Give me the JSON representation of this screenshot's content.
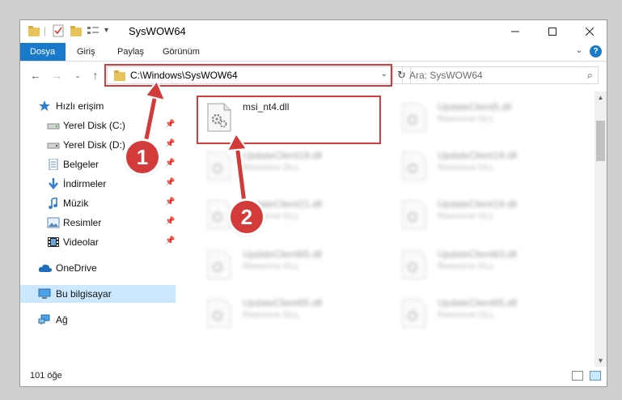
{
  "window": {
    "title": "SysWOW64"
  },
  "ribbon": {
    "tabs": [
      {
        "label": "Dosya"
      },
      {
        "label": "Giriş"
      },
      {
        "label": "Paylaş"
      },
      {
        "label": "Görünüm"
      }
    ],
    "help_label": "?"
  },
  "address": {
    "path": "C:\\Windows\\SysWOW64"
  },
  "search": {
    "placeholder": "Ara: SysWOW64"
  },
  "sidebar": {
    "items": [
      {
        "label": "Hızlı erişim",
        "icon": "star-icon"
      },
      {
        "label": "Yerel Disk (C:)",
        "icon": "drive-icon"
      },
      {
        "label": "Yerel Disk (D:)",
        "icon": "drive-icon"
      },
      {
        "label": "Belgeler",
        "icon": "documents-icon"
      },
      {
        "label": "İndirmeler",
        "icon": "downloads-icon"
      },
      {
        "label": "Müzik",
        "icon": "music-icon"
      },
      {
        "label": "Resimler",
        "icon": "pictures-icon"
      },
      {
        "label": "Videolar",
        "icon": "videos-icon"
      },
      {
        "label": "OneDrive",
        "icon": "cloud-icon"
      },
      {
        "label": "Bu bilgisayar",
        "icon": "computer-icon"
      },
      {
        "label": "Ağ",
        "icon": "network-icon"
      }
    ]
  },
  "files": {
    "primary": {
      "name": "msi_nt4.dll"
    },
    "others": [
      {
        "name": "UpdateClient5.dll",
        "type": "Resource DLL"
      },
      {
        "name": "UpdateClient19.dll",
        "type": "Resource DLL"
      },
      {
        "name": "UpdateClient19.dll",
        "type": "Resource DLL"
      },
      {
        "name": "UpdateClient21.dll",
        "type": "Resource DLL"
      },
      {
        "name": "UpdateClient19.dll",
        "type": "Resource DLL"
      },
      {
        "name": "UpdateClient65.dll",
        "type": "Resource DLL"
      },
      {
        "name": "UpdateClient63.dll",
        "type": "Resource DLL"
      },
      {
        "name": "UpdateClient65.dll",
        "type": "Resource DLL"
      },
      {
        "name": "UpdateClient65.dll",
        "type": "Resource DLL"
      }
    ]
  },
  "status": {
    "item_count": "101 öğe"
  },
  "annotations": {
    "step1": "1",
    "step2": "2"
  },
  "colors": {
    "accent": "#1979ca",
    "highlight_red": "#d23c3c",
    "selected_bg": "#cce8ff"
  }
}
